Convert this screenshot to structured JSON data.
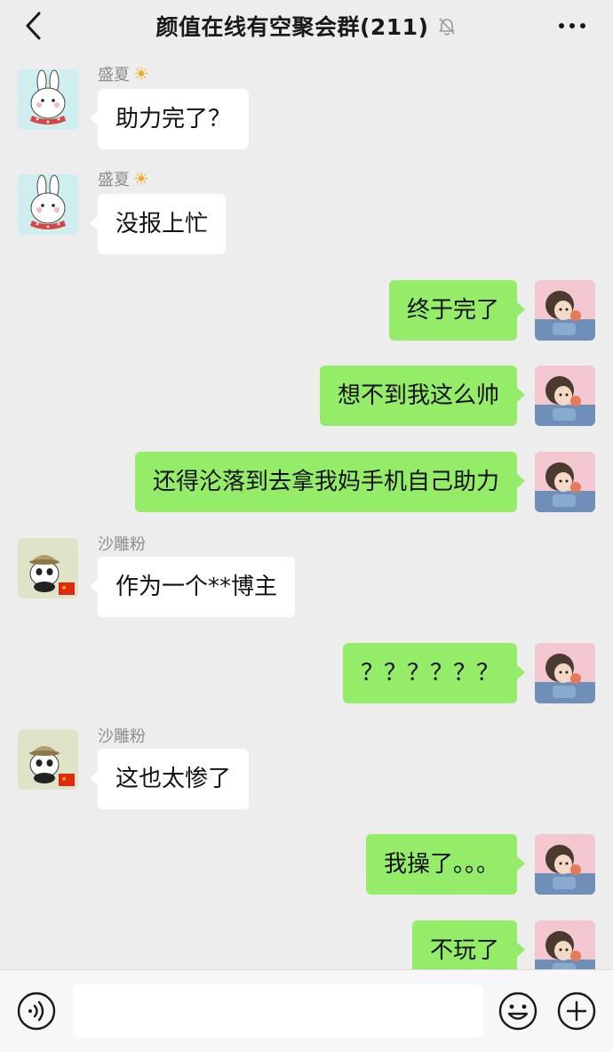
{
  "header": {
    "title": "颜值在线有空聚会群(211)",
    "back_icon": "chevron-left-icon",
    "mute_icon": "bell-off-icon",
    "more_icon": "more-dots-icon"
  },
  "users": {
    "shengxia": {
      "name": "盛夏",
      "emoji": "☀️"
    },
    "shadiaofen": {
      "name": "沙雕粉",
      "flag": "🇨🇳"
    }
  },
  "messages": [
    {
      "side": "left",
      "sender": "盛夏",
      "text": "助力完了？"
    },
    {
      "side": "left",
      "sender": "盛夏",
      "text": "没报上忙"
    },
    {
      "side": "right",
      "text": "终于完了"
    },
    {
      "side": "right",
      "text": "想不到我这么帅"
    },
    {
      "side": "right",
      "text": "还得沦落到去拿我妈手机自己助力"
    },
    {
      "side": "left",
      "sender": "沙雕粉",
      "text": "作为一个**博主"
    },
    {
      "side": "right",
      "text": "？？？？？？"
    },
    {
      "side": "left",
      "sender": "沙雕粉",
      "text": "这也太惨了"
    },
    {
      "side": "right",
      "text": "我操了。。。"
    },
    {
      "side": "right",
      "text": "不玩了"
    }
  ],
  "input": {
    "value": "",
    "placeholder": ""
  },
  "colors": {
    "self_bubble": "#95ec69",
    "other_bubble": "#ffffff",
    "background": "#ededed"
  }
}
